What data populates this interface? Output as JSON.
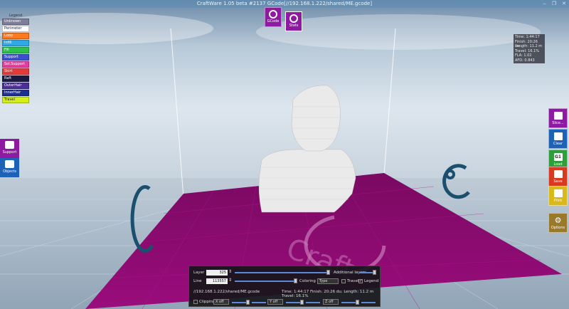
{
  "window": {
    "title": "CraftWare 1.05 beta #2137   GCode[//192.168.1.222/shared/ME.gcode]",
    "min": "‒",
    "max": "❐",
    "close": "✕"
  },
  "legend": {
    "title": "Legend",
    "items": [
      {
        "label": "Unknown",
        "color": "#7d7d9c",
        "text": "#ffffff"
      },
      {
        "label": "Perimeter",
        "color": "#ffffff",
        "text": "#1b1b3b"
      },
      {
        "label": "Loop",
        "color": "#ff7a1e",
        "text": "#ffffff"
      },
      {
        "label": "Infill",
        "color": "#2fa8e6",
        "text": "#ffffff"
      },
      {
        "label": "Fill",
        "color": "#2bc24b",
        "text": "#ffffff"
      },
      {
        "label": "Support",
        "color": "#3b4fd0",
        "text": "#ffffff"
      },
      {
        "label": "Sol.Support",
        "color": "#e63ca0",
        "text": "#ffffff"
      },
      {
        "label": "Skirt",
        "color": "#e53a3a",
        "text": "#ffffff"
      },
      {
        "label": "Raft",
        "color": "#1a1a40",
        "text": "#ffffff"
      },
      {
        "label": "OuterHair",
        "color": "#4a2c9a",
        "text": "#ffffff"
      },
      {
        "label": "InnerHair",
        "color": "#1d2f8f",
        "text": "#ffffff"
      },
      {
        "label": "Travel",
        "color": "#d4ee1a",
        "text": "#1b1b3b"
      }
    ]
  },
  "top_buttons": {
    "gcode": "GCode",
    "stats": "Stats"
  },
  "left_buttons": {
    "support": "Support",
    "objects": "Objects"
  },
  "right_buttons": {
    "slice": "Slice...",
    "clear": "Clear",
    "load": "Load",
    "load_glyph": "G1",
    "save": "Save",
    "print": "Print",
    "options": "Options"
  },
  "stats": [
    "Time: 1:44:17",
    "Finish: 20:26 du.",
    "Length: 11.2 m",
    "Travel: 16.1%",
    "FLA: 1.02",
    "AFD: 0.843"
  ],
  "panel": {
    "layer_label": "Layer",
    "layer_value": "325",
    "line_label": "Line",
    "line_value": "113557",
    "additional_layers_label": "Additional layers",
    "coloring_by_label": "Coloring by",
    "coloring_by_value": "Type",
    "travel_label": "Travel",
    "legend_label": "Legend",
    "path": "//192.168.1.222/shared/ME.gcode",
    "summary": "Time: 1:44:17  Finish: 20:26 du.  Length: 11.2 m  Travel: 16.1%",
    "clipping_label": "Clipping",
    "x_clip": "X off",
    "y_clip": "Y off",
    "z_clip": "Z off"
  },
  "colors": {
    "bed": "#8b0a6e",
    "accent": "#8d1aa0",
    "model": "#e6e6e6",
    "logo": "#1b4f6e"
  }
}
